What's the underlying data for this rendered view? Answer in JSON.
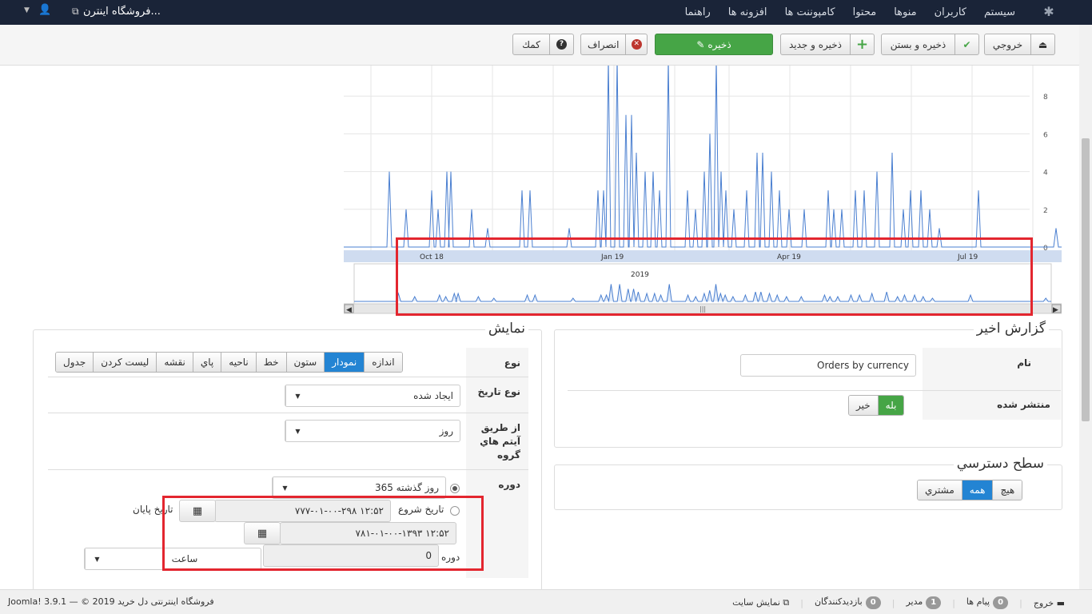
{
  "topbar": {
    "site_name": "فروشگاه اینترن...",
    "menu": [
      "سيستم",
      "كاربران",
      "منوها",
      "محتوا",
      "كامپوننت ها",
      "افزونه ها",
      "راهنما"
    ]
  },
  "toolbar": {
    "export": "خروجي",
    "save_close": "ذخيره و بستن",
    "save_new": "ذخيره و جديد",
    "save": "ذخيره",
    "cancel": "انصراف",
    "help": "كمك"
  },
  "chart_data": {
    "type": "line",
    "y_ticks": [
      "0",
      "2",
      "4",
      "6",
      "8"
    ],
    "x_ticks": [
      "Oct 18",
      "Jan 19",
      "Apr 19",
      "Jul 19"
    ],
    "navigator_label": "2019",
    "series_color": "#4a7fd0",
    "ylim": [
      0,
      10
    ]
  },
  "recent_report": {
    "legend": "گزارش اخير",
    "name_label": "نام",
    "name_value": "Orders by currency",
    "published_label": "منتشر شده",
    "yes": "بله",
    "no": "خير"
  },
  "access": {
    "legend": "سطح دسترسي",
    "options": [
      "هيچ",
      "همه",
      "مشتري"
    ]
  },
  "display": {
    "legend": "نمايش",
    "type_label": "نوع",
    "type_options": [
      "اندازه",
      "نمودار",
      "ستون",
      "خط",
      "ناحيه",
      "پاي",
      "نقشه",
      "ليست كردن",
      "جدول"
    ],
    "date_type_label": "نوع تاريخ",
    "date_type_value": "ايجاد شده",
    "group_label": "از طريق آيتم هاي گروه",
    "group_value": "روز",
    "period_label": "دوره",
    "period_value": "365 روز گذشته",
    "start_label": "تاريخ شروع",
    "start_value": "۱۲:۵۲ ۷۷۷-۰۱-۰۰-۲۹۸",
    "end_label": "تاريخ پايان",
    "end_value": "۱۲:۵۲ ۷۸۱-۰۱-۰۰-۱۳۹۳",
    "duration_label": "دوره",
    "duration_value": "0",
    "unit_value": "ساعت"
  },
  "footer": {
    "view_site": "نمايش سايت",
    "visitors_count": "0",
    "visitors": "بازديدكنندگان",
    "admin_count": "1",
    "admin": "مدير",
    "messages_count": "0",
    "messages": "پيام ها",
    "logout": "خروج",
    "copyright": "Joomla! 3.9.1 — © 2019 فروشگاه اينترنتى دل خريد"
  }
}
